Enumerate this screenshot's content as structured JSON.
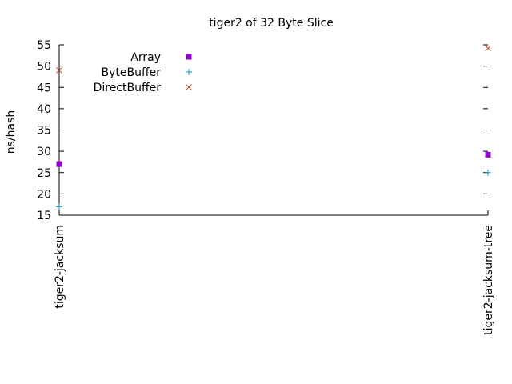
{
  "chart_data": {
    "type": "scatter",
    "title": "tiger2 of 32 Byte Slice",
    "xlabel": "",
    "ylabel": "ns/hash",
    "categories": [
      "tiger2-jacksum",
      "tiger2-jacksum-tree"
    ],
    "ylim": [
      15,
      55
    ],
    "yticks": [
      15,
      20,
      25,
      30,
      35,
      40,
      45,
      50,
      55
    ],
    "grid": false,
    "legend": "top-left",
    "series": [
      {
        "name": "Array",
        "marker": "square",
        "color": "#9400d3",
        "values": [
          27,
          29.2
        ]
      },
      {
        "name": "ByteBuffer",
        "marker": "plus",
        "color": "#009ed7",
        "values": [
          17,
          25
        ]
      },
      {
        "name": "DirectBuffer",
        "marker": "cross",
        "color": "#b8502c",
        "values": [
          49,
          54.2
        ]
      }
    ]
  }
}
